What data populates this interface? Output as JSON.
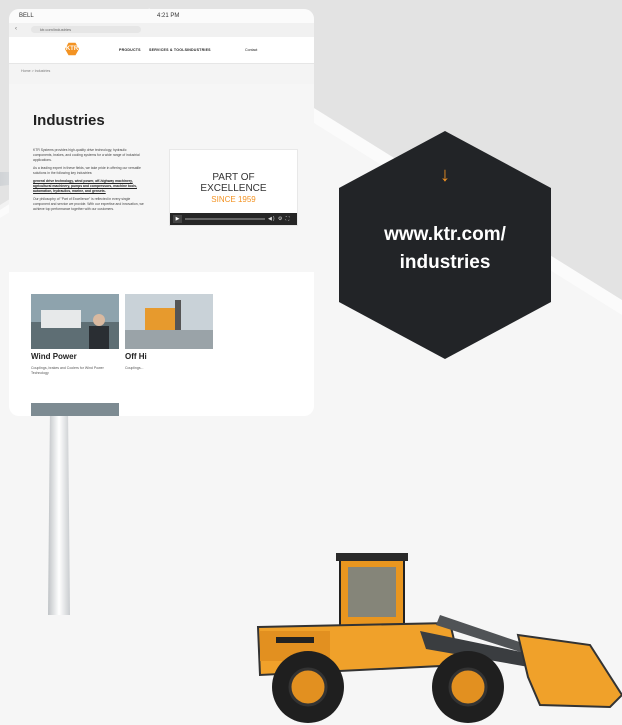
{
  "badge": {
    "arrow": "↓",
    "url_line1": "www.ktr.com/",
    "url_line2": "industries"
  },
  "tablet": {
    "status": {
      "carrier": "BELL",
      "time": "4:21 PM"
    },
    "url": "ktr.com/industries",
    "nav": {
      "logo": "KTR",
      "menu": [
        "PRODUCTS",
        "SERVICES & TOOLS",
        "INDUSTRIES"
      ],
      "contact": "Contact"
    },
    "breadcrumb": "Home  >  Industries",
    "page_title": "Industries",
    "intro": {
      "p1": "KTR Systems provides high-quality drive technology, hydraulic components, brakes, and cooling systems for a wide range of industrial applications.",
      "p2": "As a leading expert in these fields, we take pride in offering our versatile solutions in the following key industries:",
      "links": "general drive technology, wind power, off-highway machinery, agricultural machinery, pumps and compressors, machine tools, automation, hydraulics, marine, and gensets.",
      "p3": "Our philosophy of \"Part of Excellence\" is reflected in every single component and service we provide. With our expertise and innovation, we achieve top performance together with our customers."
    },
    "video": {
      "line1": "PART OF",
      "line2": "EXCELLENCE",
      "line3": "SINCE 1959",
      "controls": "◀) ⚙ ⛶"
    },
    "cards": [
      {
        "title": "Wind Power",
        "text": "Couplings, brakes and Coolers for Wind Power Technology"
      },
      {
        "title": "Off Hi",
        "text": "Couplings..."
      }
    ]
  }
}
